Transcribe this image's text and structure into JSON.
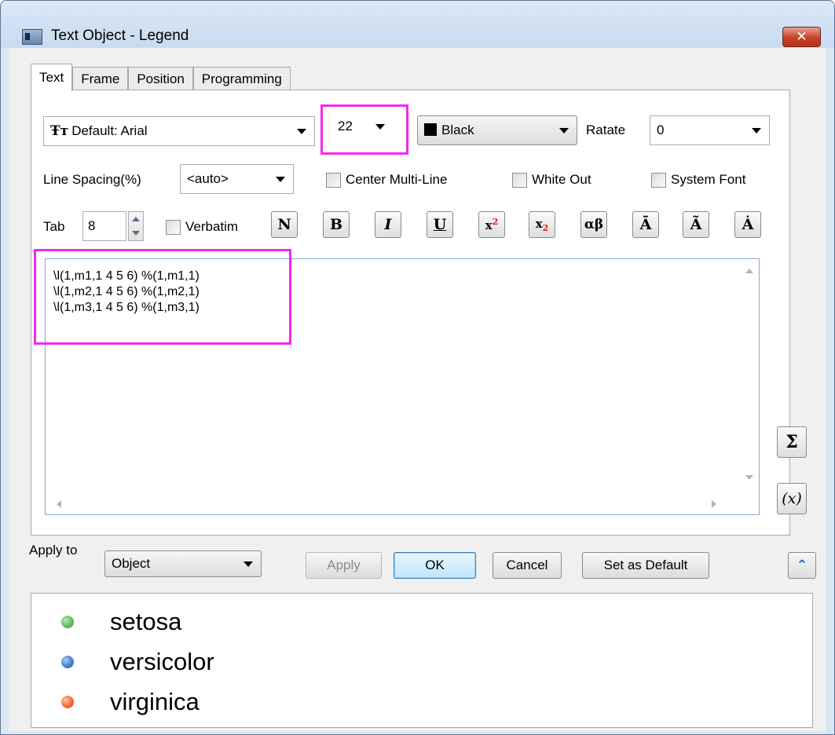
{
  "window": {
    "title": "Text Object - Legend",
    "close_glyph": "✕"
  },
  "tabs": [
    {
      "label": "Text",
      "active": true
    },
    {
      "label": "Frame",
      "active": false
    },
    {
      "label": "Position",
      "active": false
    },
    {
      "label": "Programming",
      "active": false
    }
  ],
  "font": {
    "icon": "font-icon",
    "value": "Default: Arial"
  },
  "size": {
    "value": "22"
  },
  "color": {
    "value": "Black",
    "swatch": "#000000"
  },
  "rotate": {
    "label": "Ratate",
    "value": "0"
  },
  "line_spacing": {
    "label": "Line Spacing(%)",
    "value": "<auto>"
  },
  "options": {
    "center_multiline": "Center Multi-Line",
    "white_out": "White Out",
    "system_font": "System Font",
    "verbatim": "Verbatim"
  },
  "tab": {
    "label": "Tab",
    "value": "8"
  },
  "format_buttons": {
    "normal": "N",
    "bold": "B",
    "italic": "I",
    "underline": "U",
    "superscript_base": "x",
    "superscript_mark": "2",
    "subscript_base": "x",
    "subscript_mark": "2",
    "greek": "αβ",
    "overbar": "Ā",
    "tilde": "Ã",
    "dot": "Ȧ"
  },
  "editor": {
    "lines": [
      "\\l(1,m1,1 4 5 6) %(1,m1,1)",
      "\\l(1,m2,1 4 5 6) %(1,m2,1)",
      "\\l(1,m3,1 4 5 6) %(1,m3,1)"
    ]
  },
  "side_buttons": {
    "sigma": "Σ",
    "function": "(x)"
  },
  "apply_to": {
    "label": "Apply to",
    "value": "Object"
  },
  "buttons": {
    "apply": "Apply",
    "ok": "OK",
    "cancel": "Cancel",
    "set_default": "Set as Default",
    "collapse": "⌃"
  },
  "legend_preview": [
    {
      "label": "setosa",
      "color": "#5cb85c"
    },
    {
      "label": "versicolor",
      "color": "#3a7dc9"
    },
    {
      "label": "virginica",
      "color": "#f2662b"
    }
  ]
}
